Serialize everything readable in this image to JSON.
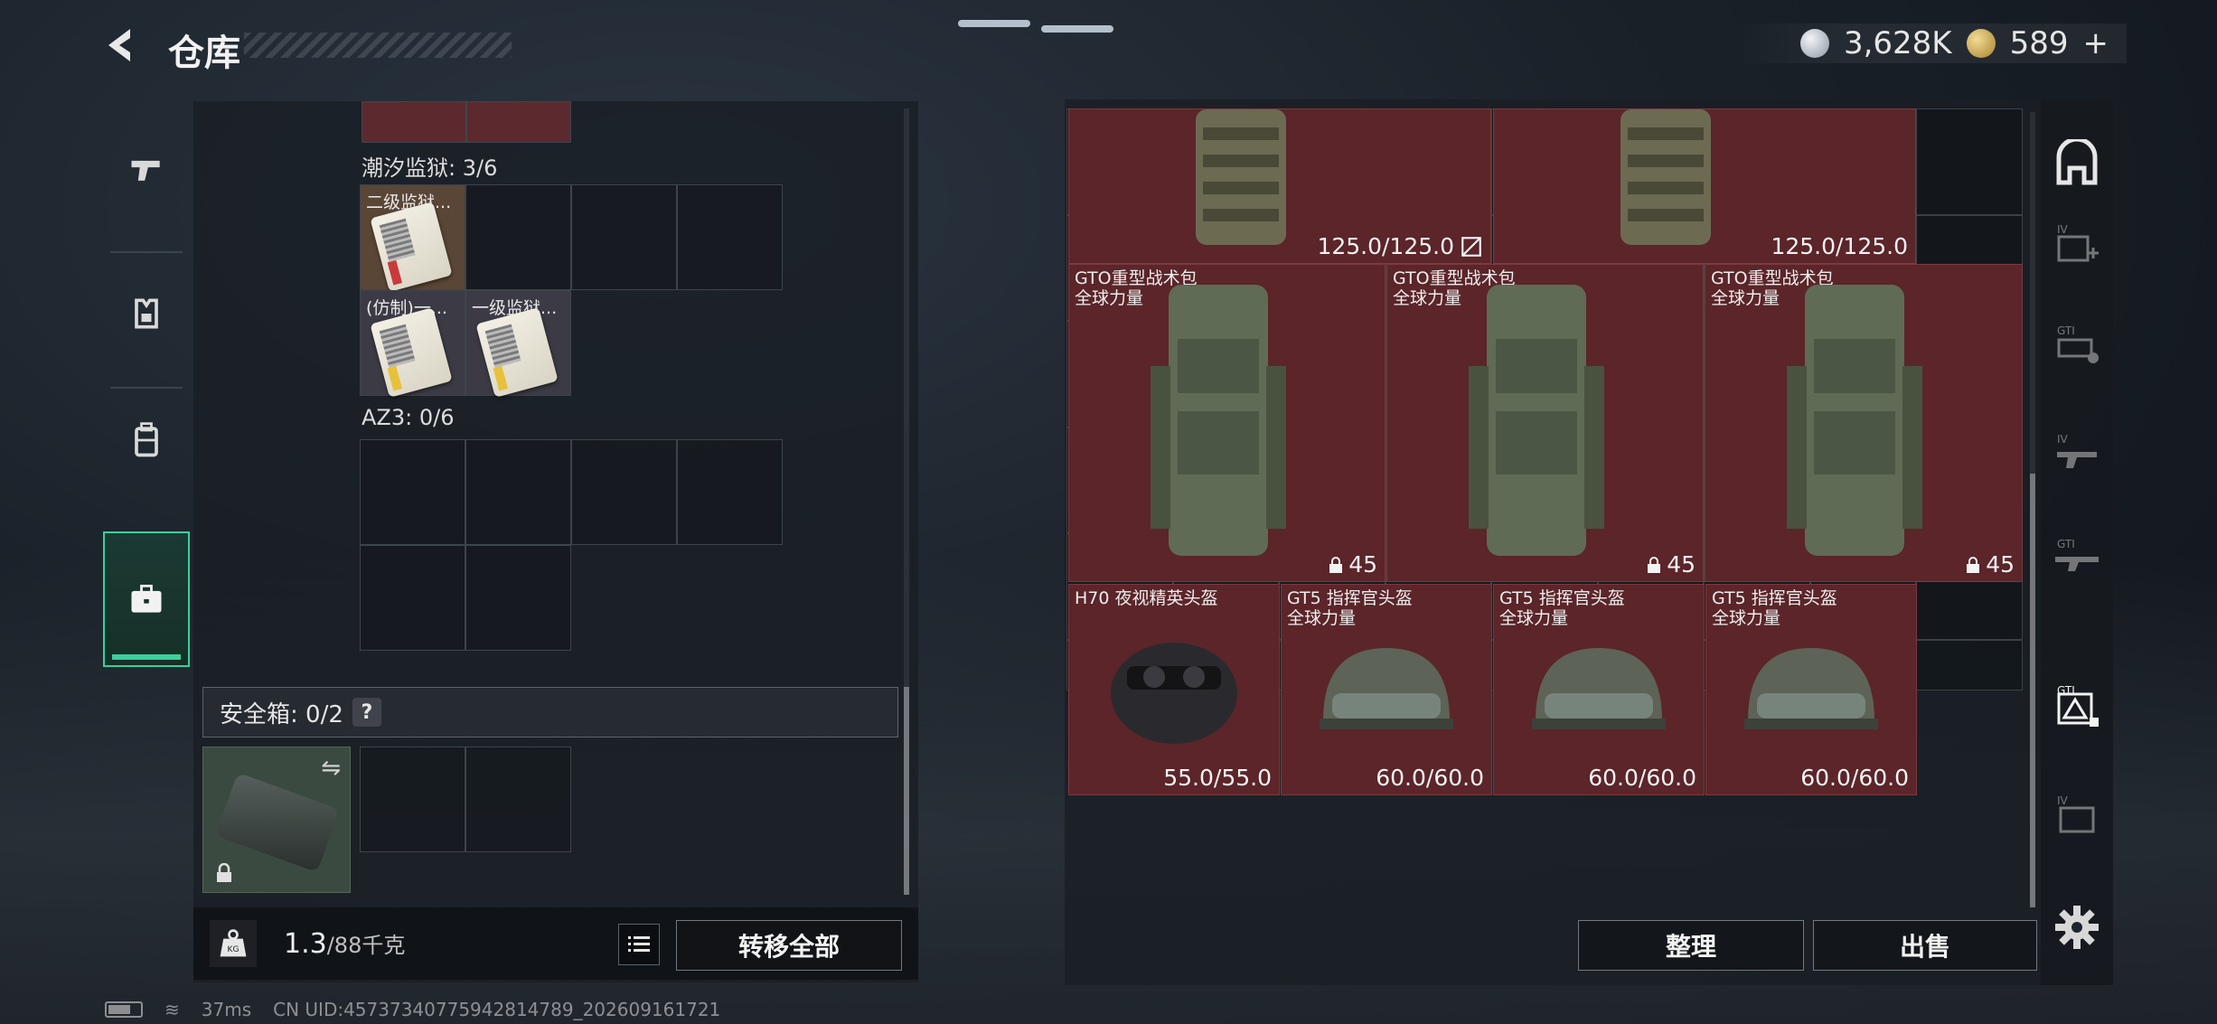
{
  "header": {
    "title": "仓库",
    "currency": [
      {
        "icon": "silver-coin-icon",
        "value": "3,628K"
      },
      {
        "icon": "gold-coin-icon",
        "value": "589"
      }
    ],
    "add_label": "+"
  },
  "tabs": [
    {
      "name": "weapons",
      "icon": "pistol-icon"
    },
    {
      "name": "armor",
      "icon": "armor-icon"
    },
    {
      "name": "backpacks",
      "icon": "backpack-icon"
    },
    {
      "name": "keys",
      "icon": "briefcase-icon",
      "active": true
    }
  ],
  "left": {
    "sections": [
      {
        "label": "潮汐监狱: 3/6"
      },
      {
        "label": "AZ3: 0/6"
      }
    ],
    "key_items": [
      {
        "name": "二级监狱...",
        "rarity": "orange"
      },
      {
        "name": "(仿制)一...",
        "rarity": "purple"
      },
      {
        "name": "一级监狱...",
        "rarity": "purple"
      }
    ],
    "safe_box": {
      "label": "安全箱: 0/2",
      "help": "?"
    },
    "weight": {
      "value": "1.3",
      "unit": "/88千克",
      "icon_text": "KG"
    },
    "transfer_all": "转移全部"
  },
  "stash": {
    "top_items": [
      {
        "durability": "125.0/125.0",
        "unsorted": true
      },
      {
        "durability": "125.0/125.0"
      }
    ],
    "backpacks": [
      {
        "name": "GTO重型战术包",
        "sub": "全球力量",
        "count": "45"
      },
      {
        "name": "GTO重型战术包",
        "sub": "全球力量",
        "count": "45"
      },
      {
        "name": "GTO重型战术包",
        "sub": "全球力量",
        "count": "45"
      }
    ],
    "helmets": [
      {
        "name": "H70 夜视精英头盔",
        "sub": "",
        "durability": "55.0/55.0"
      },
      {
        "name": "GT5 指挥官头盔",
        "sub": "全球力量",
        "durability": "60.0/60.0"
      },
      {
        "name": "GT5 指挥官头盔",
        "sub": "全球力量",
        "durability": "60.0/60.0"
      },
      {
        "name": "GT5 指挥官头盔",
        "sub": "全球力量",
        "durability": "60.0/60.0"
      }
    ]
  },
  "sidebar_labels": [
    "IV",
    "GTI",
    "IV",
    "GTI",
    "GTI",
    "IV"
  ],
  "buttons": {
    "tidy": "整理",
    "sell": "出售"
  },
  "status": {
    "ping": "37ms",
    "uid": "CN UID:4573734077594281​4789_202609161721"
  },
  "colors": {
    "accent": "#3ccf9b",
    "item_red": "#5b2529"
  }
}
